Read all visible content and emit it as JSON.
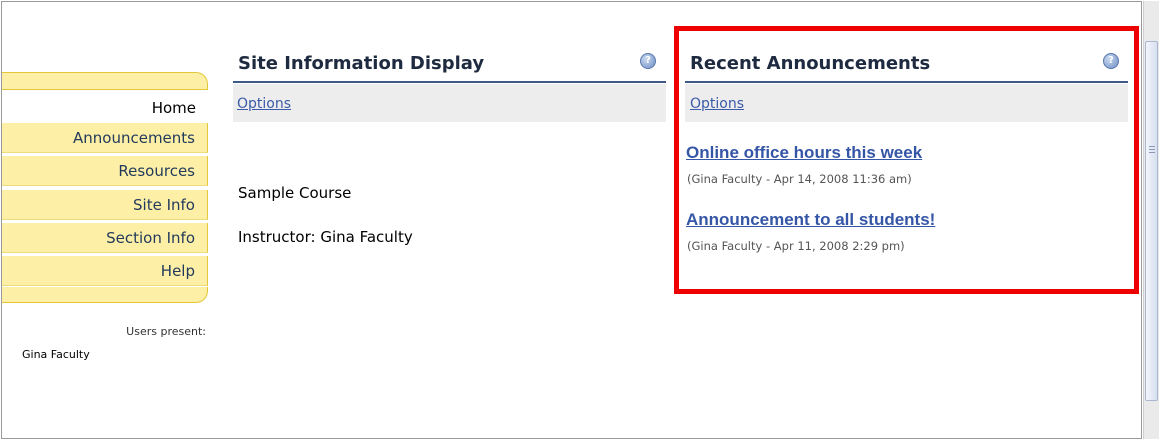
{
  "nav": {
    "items": [
      {
        "label": "Home",
        "active": true
      },
      {
        "label": "Announcements",
        "active": false
      },
      {
        "label": "Resources",
        "active": false
      },
      {
        "label": "Site Info",
        "active": false
      },
      {
        "label": "Section Info",
        "active": false
      },
      {
        "label": "Help",
        "active": false
      }
    ],
    "users_present_label": "Users present:",
    "users_present": [
      "Gina Faculty"
    ]
  },
  "site_info": {
    "title": "Site Information Display",
    "options_label": "Options",
    "lines": [
      "Sample Course",
      "Instructor: Gina Faculty"
    ],
    "help_icon": "help-icon"
  },
  "announcements": {
    "title": "Recent Announcements",
    "options_label": "Options",
    "help_icon": "help-icon",
    "items": [
      {
        "title": "Online office hours this week",
        "meta": "(Gina Faculty - Apr 14, 2008 11:36 am)"
      },
      {
        "title": "Announcement to all students!",
        "meta": "(Gina Faculty - Apr 11, 2008 2:29 pm)"
      }
    ]
  },
  "colors": {
    "nav_bg": "#fdf0a6",
    "link": "#3556a6",
    "title_rule": "#3d5a86",
    "highlight": "#ee0000"
  }
}
